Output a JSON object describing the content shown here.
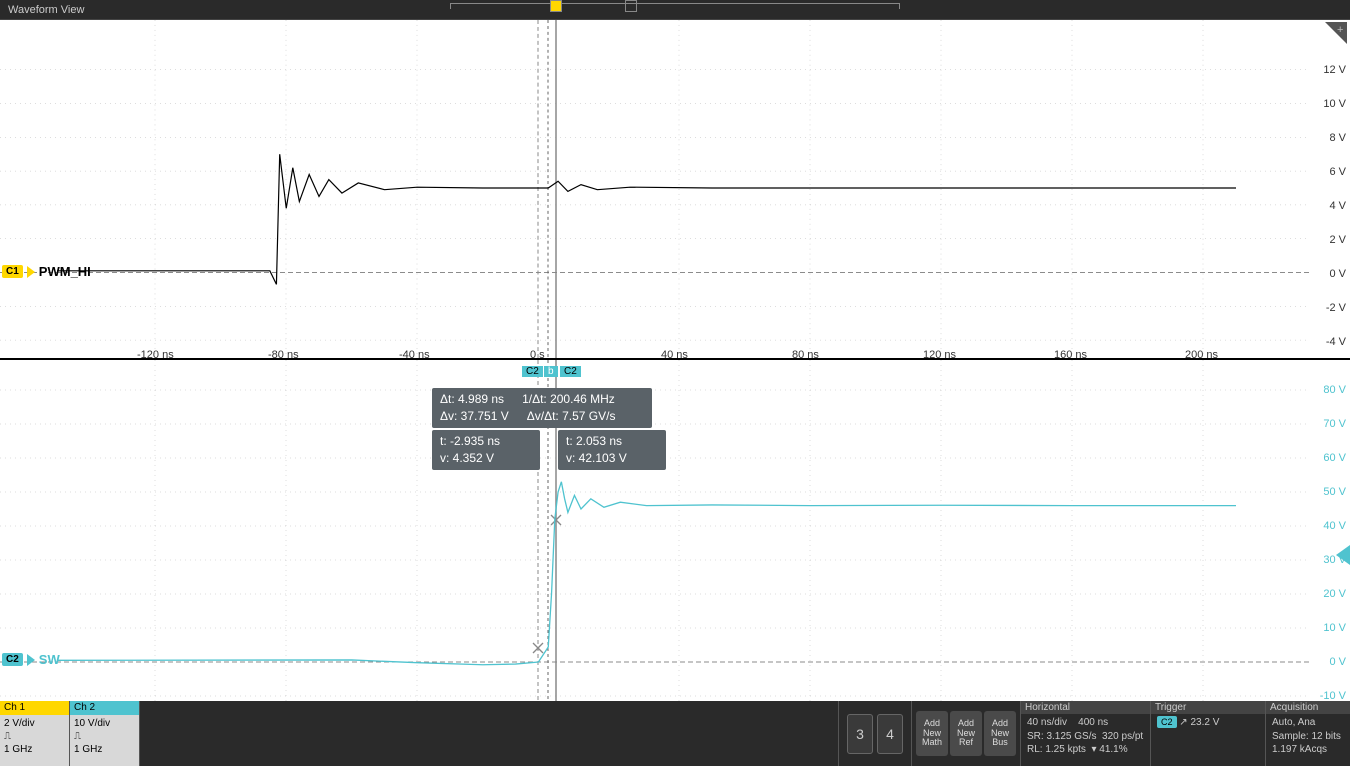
{
  "title": "Waveform View",
  "channels": {
    "ch1": {
      "badge": "C1",
      "name": "PWM_HI",
      "panel_title": "Ch 1",
      "scale": "2 V/div",
      "bw": "1 GHz",
      "color": "#ffd700"
    },
    "ch2": {
      "badge": "C2",
      "name": "SW",
      "panel_title": "Ch 2",
      "scale": "10 V/div",
      "bw": "1 GHz",
      "color": "#4fc3cf"
    }
  },
  "axes": {
    "ch1_v": [
      "12 V",
      "10 V",
      "8 V",
      "6 V",
      "4 V",
      "2 V",
      "0 V",
      "-2 V",
      "-4 V"
    ],
    "ch2_v": [
      "80 V",
      "70 V",
      "60 V",
      "50 V",
      "40 V",
      "30 V",
      "20 V",
      "10 V",
      "0 V",
      "-10 V"
    ],
    "time": [
      "-120 ns",
      "-80 ns",
      "-40 ns",
      "0 s",
      "40 ns",
      "80 ns",
      "120 ns",
      "160 ns",
      "200 ns"
    ]
  },
  "cursors": {
    "tags": {
      "a": "C2",
      "b": "b",
      "c": "C2"
    },
    "delta": {
      "dt": "Δt: 4.989 ns",
      "inv_dt": "1/Δt: 200.46 MHz",
      "dv": "Δv: 37.751 V",
      "slope": "Δv/Δt: 7.57 GV/s"
    },
    "a": {
      "t": "t: -2.935 ns",
      "v": "v: 4.352 V"
    },
    "b2": {
      "t": "t: 2.053 ns",
      "v": "v: 42.103 V"
    }
  },
  "buttons": {
    "num3": "3",
    "num4": "4",
    "add_math": "Add\nNew\nMath",
    "add_ref": "Add\nNew\nRef",
    "add_bus": "Add\nNew\nBus"
  },
  "horizontal": {
    "title": "Horizontal",
    "scale": "40 ns/div",
    "pos": "400 ns",
    "sr": "SR: 3.125 GS/s",
    "res": "320 ps/pt",
    "rl": "RL: 1.25 kpts",
    "pct": "▾ 41.1%"
  },
  "trigger": {
    "title": "Trigger",
    "ch": "C2",
    "edge": "↗",
    "level": "23.2 V"
  },
  "acquisition": {
    "title": "Acquisition",
    "mode": "Auto,     Ana",
    "sample": "Sample: 12 bits",
    "acqs": "1.197 kAcqs"
  },
  "chart_data": {
    "type": "line",
    "time_axis": {
      "min_ns": -150,
      "max_ns": 210,
      "div_ns": 40,
      "ticks": [
        -120,
        -80,
        -40,
        0,
        40,
        80,
        120,
        160,
        200
      ]
    },
    "ch1": {
      "label": "PWM_HI",
      "v_per_div": 2,
      "v_min": -4,
      "v_max": 12,
      "zero_v": 0,
      "description": "Step from ~0V to ~5V at t≈-83ns with overshoot to ~7V and damped ringing settling ~5V",
      "samples_ns_v": [
        [
          -150,
          0.1
        ],
        [
          -85,
          0.1
        ],
        [
          -83,
          -0.7
        ],
        [
          -82,
          7.0
        ],
        [
          -80,
          3.8
        ],
        [
          -78,
          6.2
        ],
        [
          -76,
          4.2
        ],
        [
          -73,
          5.8
        ],
        [
          -70,
          4.5
        ],
        [
          -67,
          5.5
        ],
        [
          -63,
          4.7
        ],
        [
          -58,
          5.3
        ],
        [
          -50,
          4.9
        ],
        [
          -40,
          5.05
        ],
        [
          -20,
          5.0
        ],
        [
          0,
          5.0
        ],
        [
          3,
          5.4
        ],
        [
          6,
          4.8
        ],
        [
          10,
          5.2
        ],
        [
          15,
          4.9
        ],
        [
          25,
          5.05
        ],
        [
          50,
          5.0
        ],
        [
          100,
          5.0
        ],
        [
          150,
          5.0
        ],
        [
          210,
          5.0
        ]
      ]
    },
    "ch2": {
      "label": "SW",
      "v_per_div": 10,
      "v_min": -10,
      "v_max": 80,
      "zero_v": 0,
      "description": "Low ~0V until t≈0 then fast rise to ~48V settling ~46V with small ringing",
      "samples_ns_v": [
        [
          -150,
          0.5
        ],
        [
          -60,
          0.6
        ],
        [
          -40,
          -0.2
        ],
        [
          -20,
          -0.8
        ],
        [
          -10,
          -0.6
        ],
        [
          -3,
          0
        ],
        [
          0,
          4.4
        ],
        [
          1,
          20
        ],
        [
          2,
          42
        ],
        [
          3,
          50
        ],
        [
          4,
          53
        ],
        [
          5,
          48
        ],
        [
          6,
          44
        ],
        [
          8,
          49
        ],
        [
          10,
          45
        ],
        [
          13,
          48
        ],
        [
          17,
          45.5
        ],
        [
          22,
          47
        ],
        [
          30,
          46
        ],
        [
          50,
          46.2
        ],
        [
          80,
          46
        ],
        [
          120,
          46.1
        ],
        [
          160,
          46
        ],
        [
          210,
          46
        ]
      ]
    },
    "cursors": {
      "a_t_ns": -2.935,
      "a_v": 4.352,
      "b_t_ns": 2.053,
      "b_v": 42.103
    },
    "trigger_level_v": 23.2
  }
}
